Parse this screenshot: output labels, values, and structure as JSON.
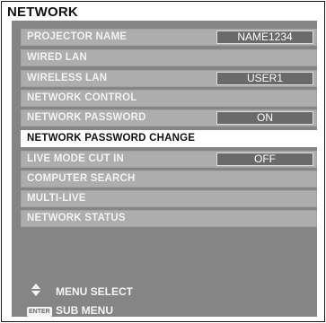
{
  "header": {
    "title": "NETWORK"
  },
  "menu": {
    "items": [
      {
        "label": "PROJECTOR NAME",
        "value": "NAME1234"
      },
      {
        "label": "WIRED LAN"
      },
      {
        "label": "WIRELESS LAN",
        "value": "USER1"
      },
      {
        "label": "NETWORK CONTROL"
      },
      {
        "label": "NETWORK PASSWORD",
        "value": "ON"
      },
      {
        "label": "NETWORK PASSWORD CHANGE",
        "selected": true
      },
      {
        "label": "LIVE MODE CUT IN",
        "value": "OFF"
      },
      {
        "label": "COMPUTER SEARCH"
      },
      {
        "label": "MULTI-LIVE"
      },
      {
        "label": "NETWORK STATUS"
      }
    ]
  },
  "footer": {
    "menu_select": {
      "icon": "up-down-arrows-icon",
      "label": "MENU SELECT"
    },
    "sub_menu": {
      "icon": "enter-key-icon",
      "key": "ENTER",
      "label": "SUB MENU"
    }
  },
  "colors": {
    "panel": "#858585",
    "item": "#adadad",
    "selected": "#ffffff",
    "value_box": "#6a6a6a"
  }
}
